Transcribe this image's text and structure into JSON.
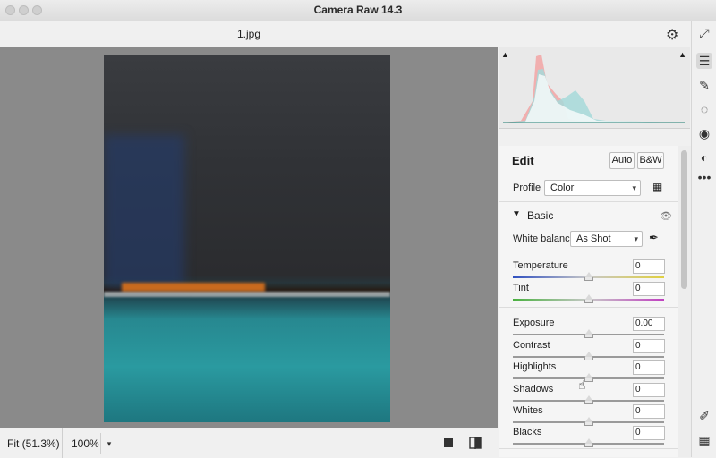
{
  "window": {
    "title": "Camera Raw 14.3"
  },
  "file": {
    "name": "1.jpg"
  },
  "bottom_bar": {
    "fit_label": "Fit (51.3%)",
    "zoom_value": "100%"
  },
  "edit_panel": {
    "title": "Edit",
    "auto_label": "Auto",
    "bw_label": "B&W",
    "profile_label": "Profile",
    "profile_value": "Color",
    "section_title": "Basic",
    "white_balance_label": "White balance",
    "white_balance_value": "As Shot",
    "sliders": [
      {
        "label": "Temperature",
        "value": "0",
        "position": 0.5
      },
      {
        "label": "Tint",
        "value": "0",
        "position": 0.5
      },
      {
        "label": "Exposure",
        "value": "0.00",
        "position": 0.5
      },
      {
        "label": "Contrast",
        "value": "0",
        "position": 0.5
      },
      {
        "label": "Highlights",
        "value": "0",
        "position": 0.5
      },
      {
        "label": "Shadows",
        "value": "0",
        "position": 0.5
      },
      {
        "label": "Whites",
        "value": "0",
        "position": 0.5
      },
      {
        "label": "Blacks",
        "value": "0",
        "position": 0.5
      }
    ]
  },
  "icons": {
    "gear": "gear-icon",
    "expand": "expand-icon",
    "edit": "sliders-icon",
    "heal": "bandage-icon",
    "mask": "mask-icon",
    "redeye": "red-eye-icon",
    "presets": "presets-icon",
    "more": "more-icon",
    "sampler": "eyedropper-icon",
    "grid": "grid-icon"
  }
}
